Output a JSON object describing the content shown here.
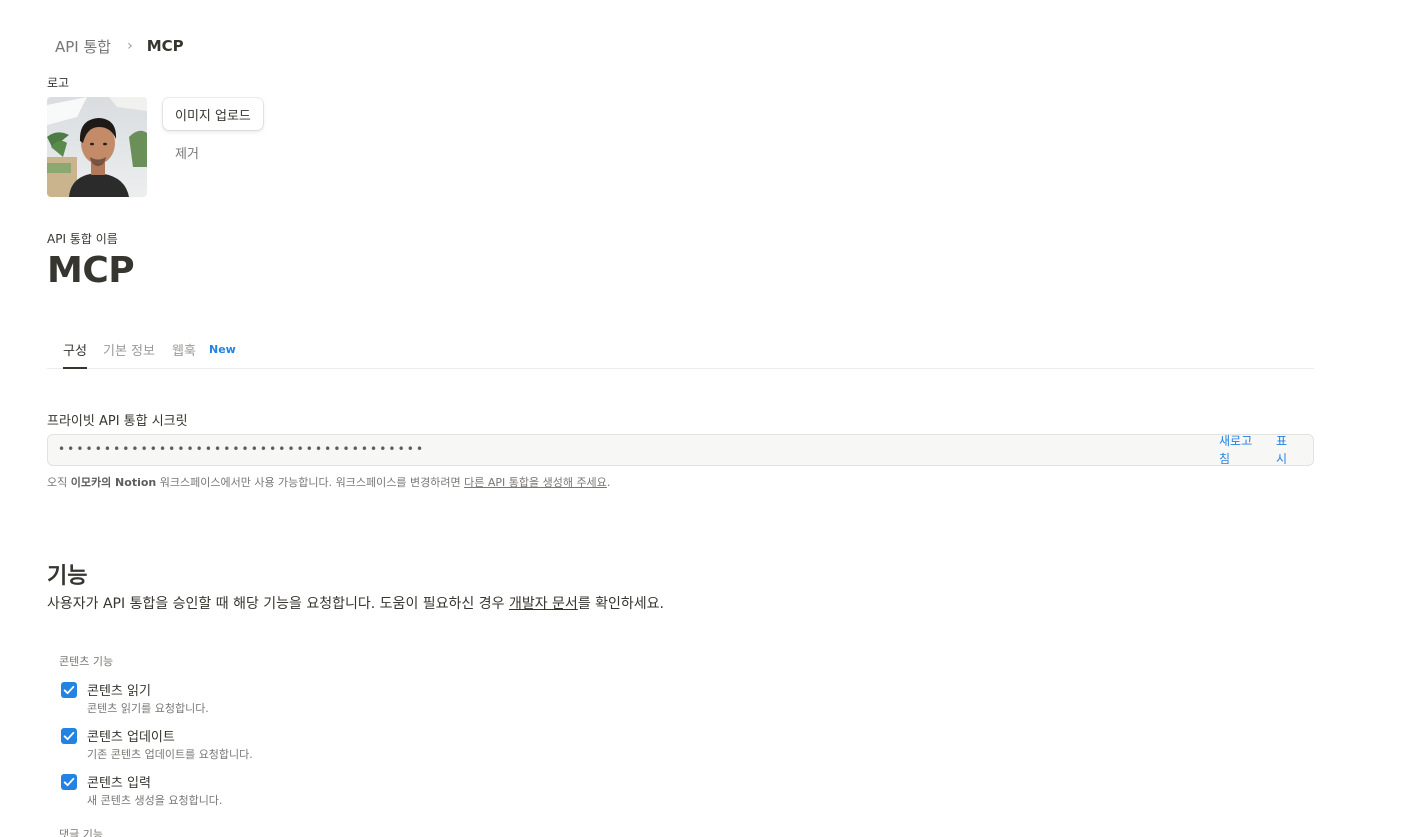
{
  "breadcrumb": {
    "parent": "API 통합",
    "separator": "›",
    "current": "MCP"
  },
  "logo": {
    "label": "로고",
    "upload_label": "이미지 업로드",
    "remove_label": "제거"
  },
  "integration_name": {
    "label": "API 통합 이름",
    "value": "MCP"
  },
  "tabs": [
    {
      "label": "구성",
      "active": true
    },
    {
      "label": "기본 정보",
      "active": false
    },
    {
      "label": "웹훅",
      "active": false
    }
  ],
  "tab_badge": "New",
  "secret": {
    "label": "프라이빗 API 통합 시크릿",
    "masked_value": "••••••••••••••••••••••••••••••••••••••••",
    "refresh_label_line1": "새로고",
    "refresh_label_line2": "침",
    "show_label_line1": "표",
    "show_label_line2": "시",
    "note_prefix": "오직 ",
    "note_workspace": "이모카의 Notion",
    "note_middle": " 워크스페이스에서만 사용 가능합니다. 워크스페이스를 변경하려면 ",
    "note_link": "다른 API 통합을 생성해 주세요",
    "note_suffix": "."
  },
  "capabilities": {
    "title": "기능",
    "desc_prefix": "사용자가 API 통합을 승인할 때 해당 기능을 요청합니다. 도움이 필요하신 경우 ",
    "desc_link": "개발자 문서",
    "desc_suffix": "를 확인하세요.",
    "content_group_label": "콘텐츠 기능",
    "items": [
      {
        "title": "콘텐츠 읽기",
        "desc": "콘텐츠 읽기를 요청합니다.",
        "checked": true
      },
      {
        "title": "콘텐츠 업데이트",
        "desc": "기존 콘텐츠 업데이트를 요청합니다.",
        "checked": true
      },
      {
        "title": "콘텐츠 입력",
        "desc": "새 콘텐츠 생성을 요청합니다.",
        "checked": true
      }
    ],
    "comment_group_label": "댓글 기능"
  },
  "colors": {
    "accent": "#2383e2",
    "text": "#37352f",
    "muted": "#787774"
  }
}
